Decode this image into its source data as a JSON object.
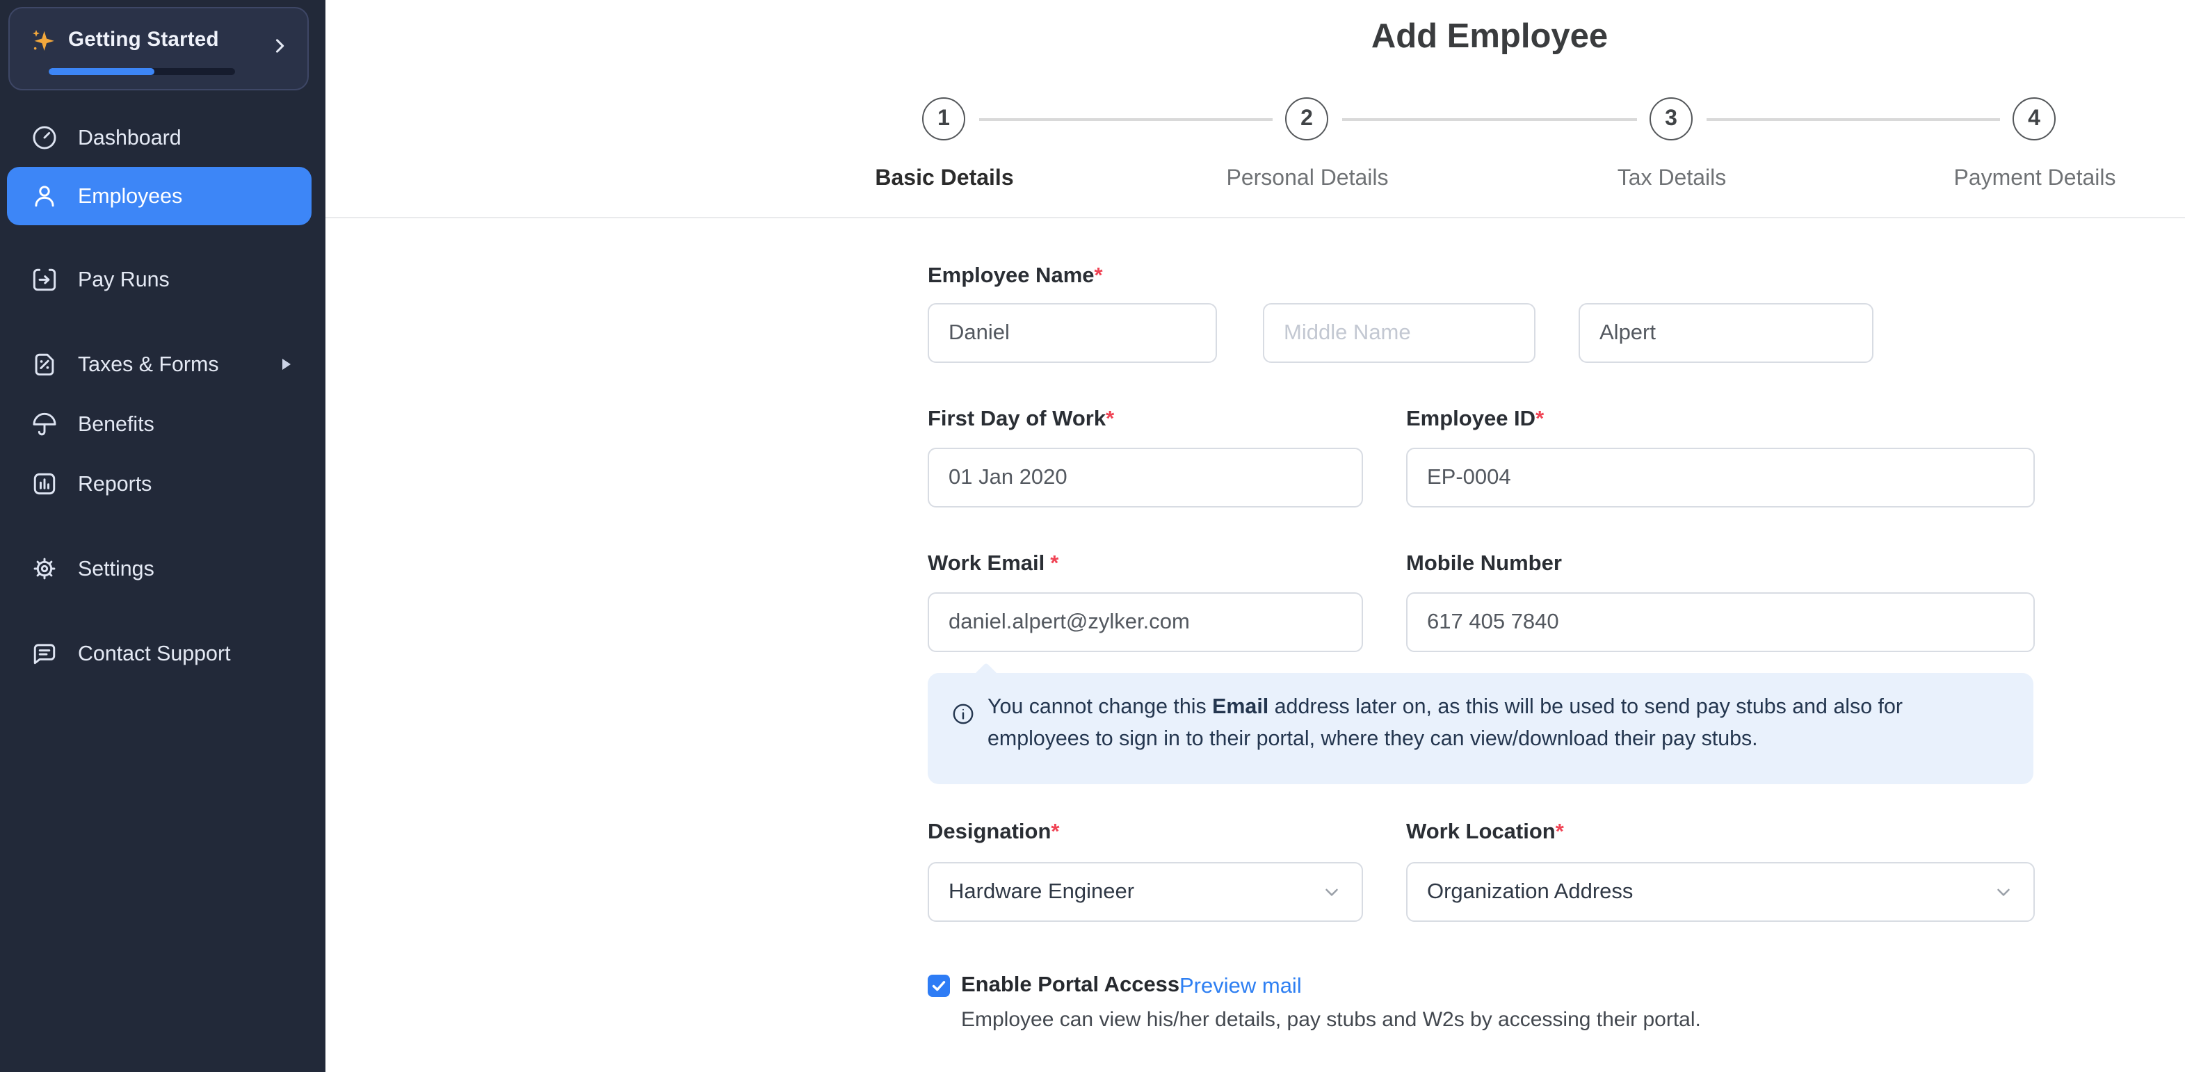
{
  "app": {
    "title": "Add Employee"
  },
  "colors": {
    "sidebar_bg": "#222939",
    "active_item_bg": "#3D86F7",
    "progress_fill": "#3D86F7",
    "link_blue": "#2E7FF2",
    "required_red": "#F04354",
    "info_box_bg": "#E9F1FC",
    "sparkle_amber": "#F3A83C",
    "checkbox_blue": "#2E7CF5"
  },
  "sidebar": {
    "getting_started": {
      "label": "Getting Started",
      "progress_pct": 57
    },
    "items": [
      {
        "label": "Dashboard",
        "icon": "dashboard-icon",
        "active": false
      },
      {
        "label": "Employees",
        "icon": "employees-icon",
        "active": true
      },
      {
        "label": "Pay Runs",
        "icon": "pay-runs-icon",
        "active": false
      },
      {
        "label": "Taxes & Forms",
        "icon": "taxes-forms-icon",
        "active": false,
        "has_submenu": true
      },
      {
        "label": "Benefits",
        "icon": "benefits-icon",
        "active": false
      },
      {
        "label": "Reports",
        "icon": "reports-icon",
        "active": false
      },
      {
        "label": "Settings",
        "icon": "settings-icon",
        "active": false
      },
      {
        "label": "Contact Support",
        "icon": "contact-support-icon",
        "active": false
      }
    ]
  },
  "stepper": {
    "steps": [
      {
        "number": "1",
        "label": "Basic Details",
        "active": true
      },
      {
        "number": "2",
        "label": "Personal Details",
        "active": false
      },
      {
        "number": "3",
        "label": "Tax Details",
        "active": false
      },
      {
        "number": "4",
        "label": "Payment Details",
        "active": false
      }
    ]
  },
  "form": {
    "required_mark": "*",
    "employee_name": {
      "label": "Employee Name",
      "first_name_value": "Daniel",
      "middle_name_placeholder": "Middle Name",
      "last_name_value": "Alpert"
    },
    "first_day_of_work": {
      "label": "First Day of Work",
      "value": "01 Jan 2020"
    },
    "employee_id": {
      "label": "Employee ID",
      "value": "EP-0004"
    },
    "work_email": {
      "label": "Work Email",
      "value": "daniel.alpert@zylker.com"
    },
    "mobile_number": {
      "label": "Mobile Number",
      "value": "617 405 7840"
    },
    "info_note": {
      "prefix": "You cannot change this ",
      "bold": "Email",
      "suffix": " address later on, as this will be used to send pay stubs and also for employees to sign in to their portal, where they can view/download their pay stubs."
    },
    "designation": {
      "label": "Designation",
      "value": "Hardware Engineer"
    },
    "work_location": {
      "label": "Work Location",
      "value": "Organization Address"
    },
    "portal_access": {
      "checked": true,
      "label": "Enable Portal Access",
      "link": "Preview mail",
      "helper": "Employee can view his/her details, pay stubs and W2s by accessing their portal."
    }
  }
}
